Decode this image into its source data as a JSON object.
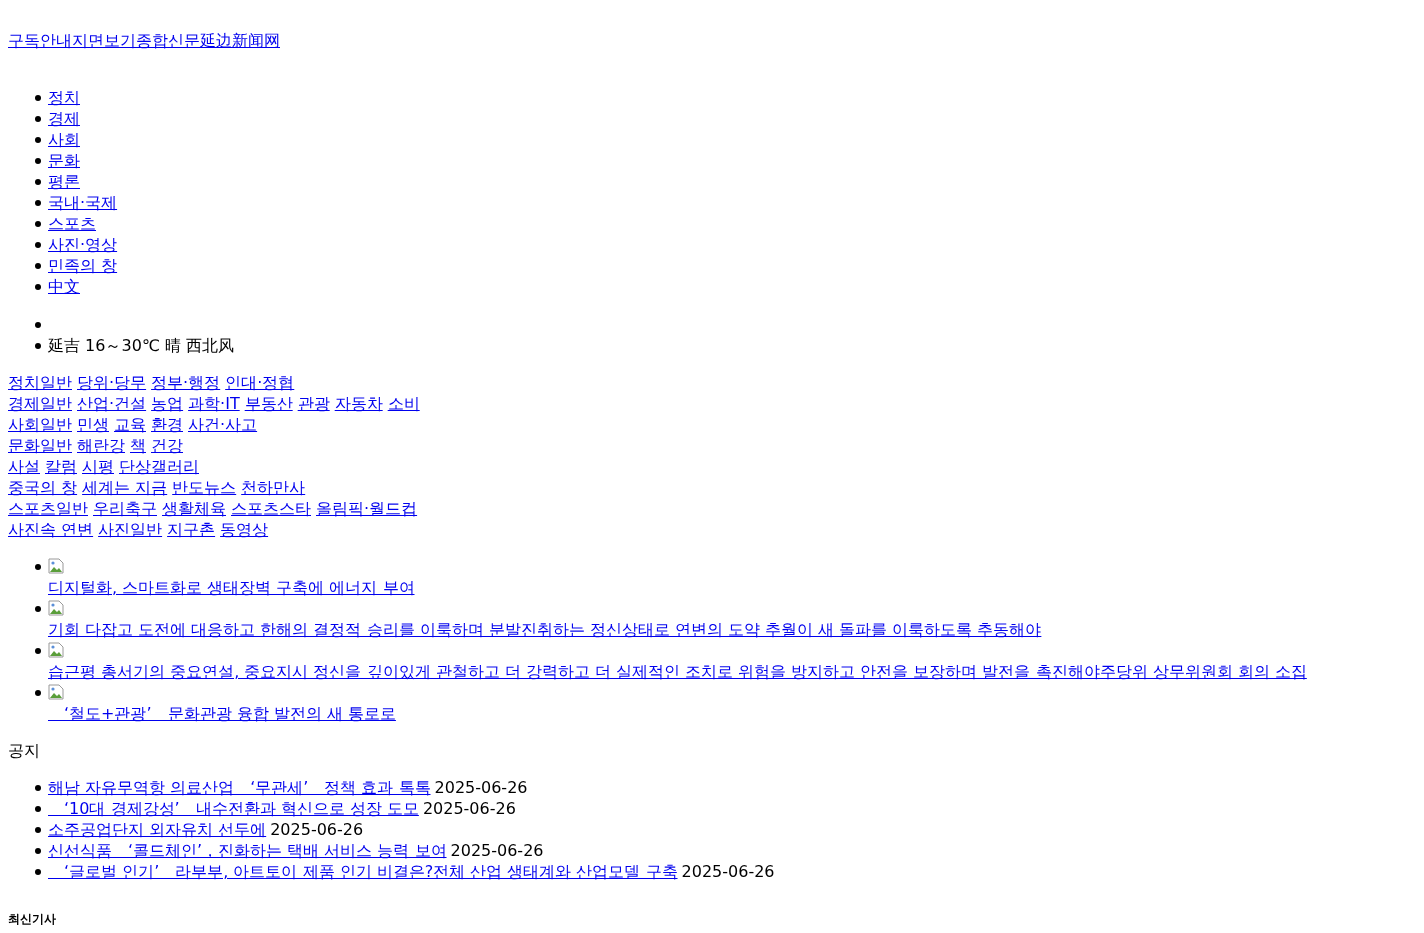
{
  "header_links": [
    "구독안내",
    "지면보기",
    "종합신문",
    "延边新闻网"
  ],
  "nav_menu": [
    "정치",
    "경제",
    "사회",
    "문화",
    "평론",
    "국내·국제",
    "스포츠",
    "사진·영상",
    "민족의 창",
    "中文"
  ],
  "weather": [
    {
      "kind": "blank"
    },
    {
      "kind": "text",
      "text": "延吉 16～30℃ 晴 西北风"
    }
  ],
  "categories": [
    [
      "정치일반",
      "당위·당무",
      "정부·행정",
      "인대·정협"
    ],
    [
      "경제일반",
      "산업·건설",
      "농업",
      "과학·IT",
      "부동산",
      "관광",
      "자동차",
      "소비"
    ],
    [
      "사회일반",
      "민생",
      "교육",
      "환경",
      "사건·사고"
    ],
    [
      "문화일반",
      "해란강",
      "책",
      "건강"
    ],
    [
      "사설",
      "칼럼",
      "시평",
      "단상갤러리"
    ],
    [
      "중국의 창",
      "세계는 지금",
      "반도뉴스",
      "천하만사"
    ],
    [
      "스포츠일반",
      "우리축구",
      "생활체육",
      "스포츠스타",
      "올림픽·월드컵"
    ],
    [
      "사진속 연변",
      "사진일반",
      "지구촌",
      "동영상"
    ]
  ],
  "featured": [
    {
      "title": "디지털화, 스마트화로 생태장벽 구축에 에너지 부여"
    },
    {
      "title": "기회 다잡고 도전에 대응하고 한해의 결정적 승리를 이룩하며 분발진취하는 정신상태로 연변의 도약 추월이 새 돌파를 이룩하도록 추동해야"
    },
    {
      "title": "습근평 총서기의 중요연설, 중요지시 정신을 깊이있게 관철하고 더 강력하고 더 실제적인 조치로 위험을 방지하고 안전을 보장하며 발전을 촉진해야주당위 상무위원회 회의 소집"
    },
    {
      "title": "　‘철도+관광’　문화관광 융합 발전의 새 통로로"
    }
  ],
  "notice": {
    "heading": "공지",
    "items": [
      {
        "title": "해남 자유무역항 의료산업　‘무관세’　정책 효과 톡톡",
        "date": "2025-06-26"
      },
      {
        "title": "　‘10대 경제강성’　내수전환과 혁신으로 성장 도모",
        "date": "2025-06-26"
      },
      {
        "title": "소주공업단지 외자유치 선두에",
        "date": "2025-06-26"
      },
      {
        "title": "신선식품　‘콜드체인’，진화하는 택배 서비스 능력 보여",
        "date": "2025-06-26"
      },
      {
        "title": "　‘글로벌 인기’　라부부, 아트토이 제품 인기 비결은?전체 산업 생태계와 산업모델 구축",
        "date": "2025-06-26"
      }
    ]
  },
  "latest": {
    "heading": "최신기사"
  }
}
